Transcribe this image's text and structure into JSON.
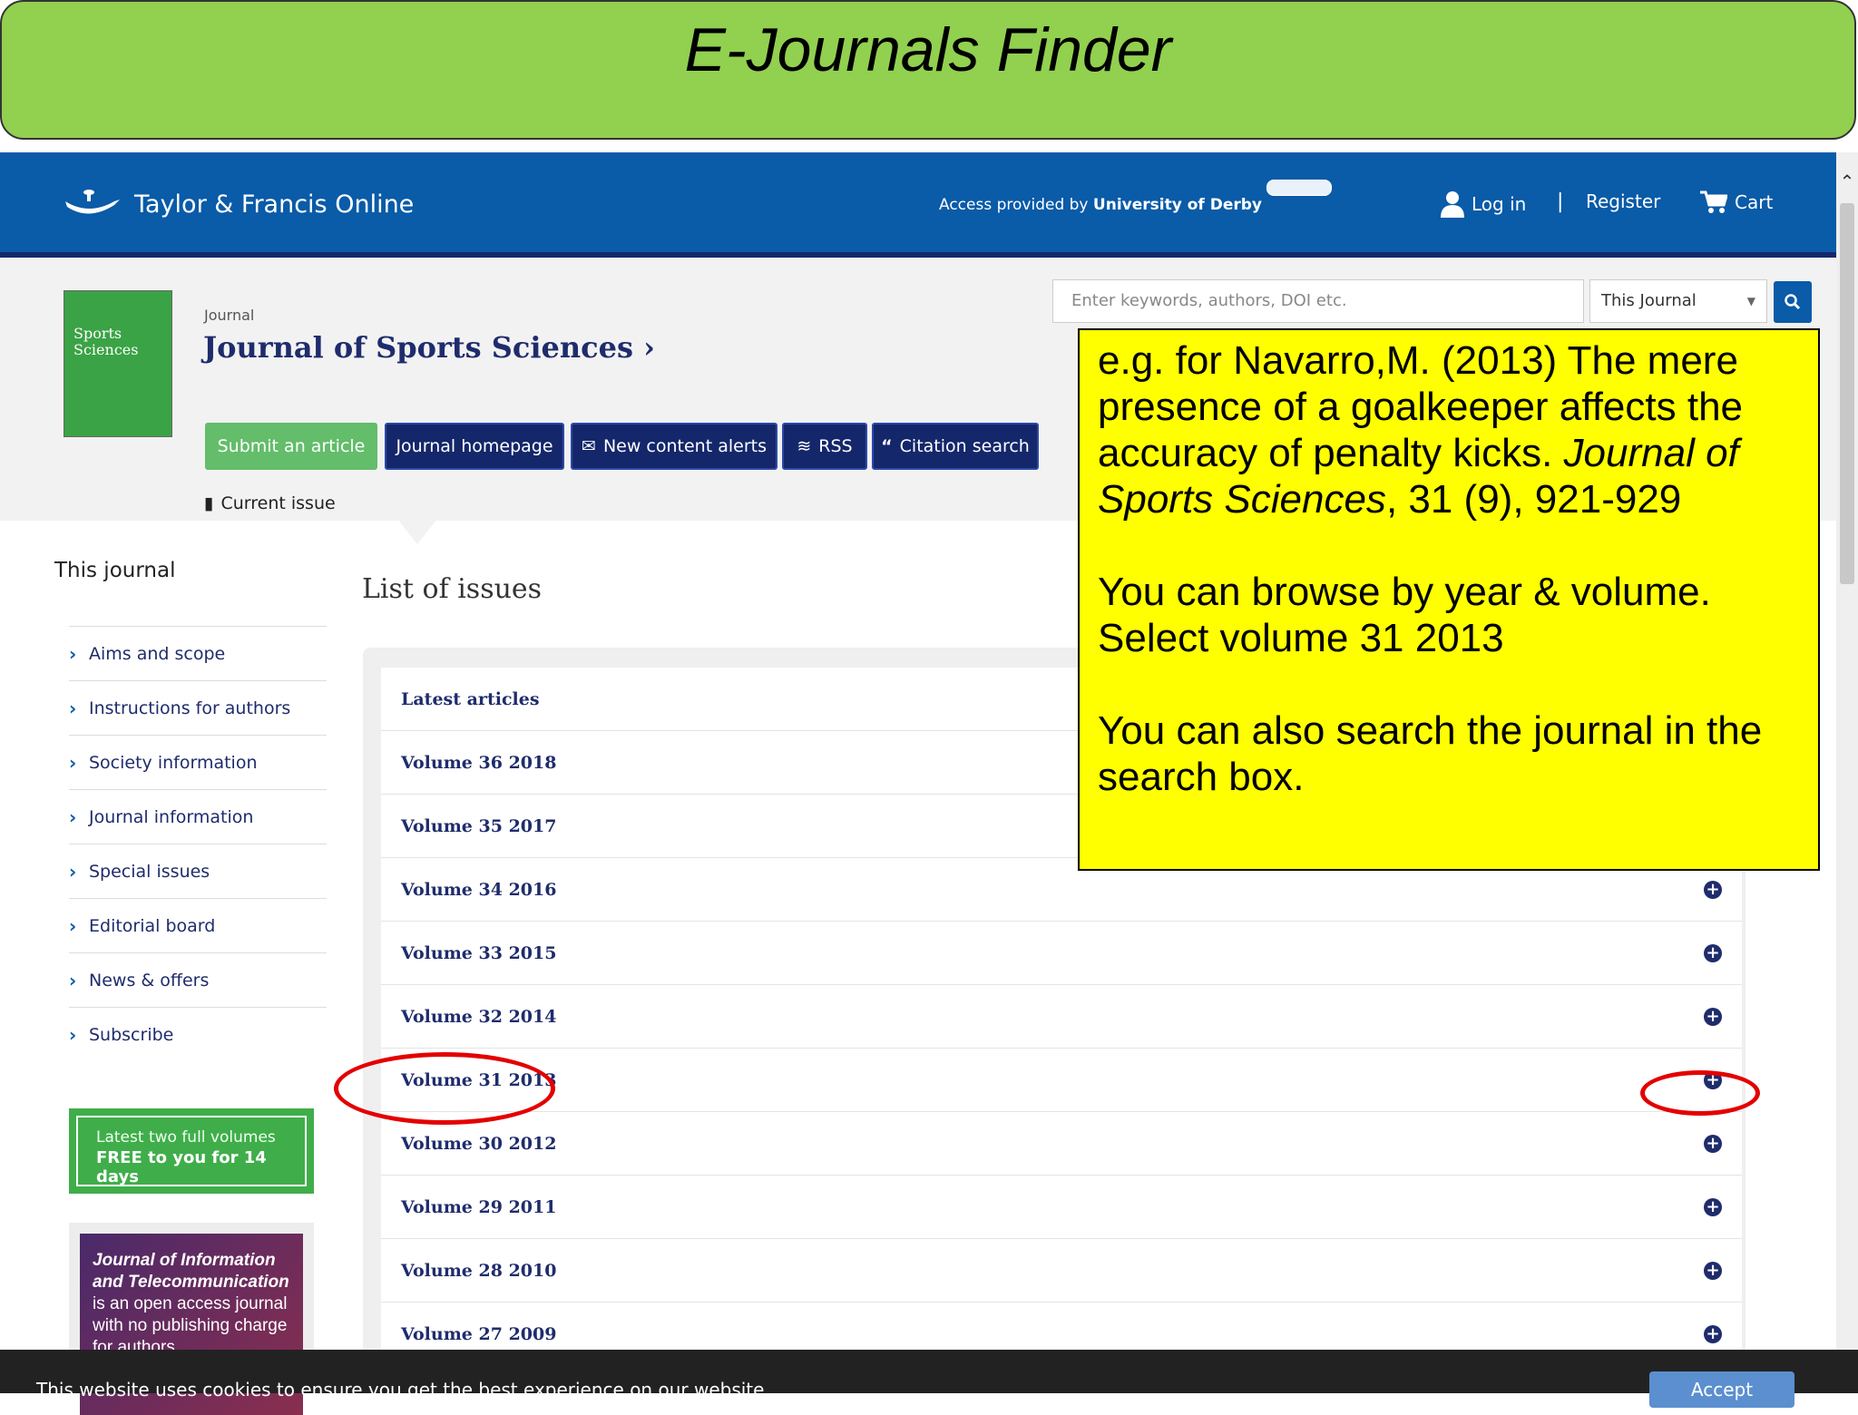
{
  "banner": {
    "title": "E-Journals Finder"
  },
  "header": {
    "logo_text": "Taylor & Francis Online",
    "access_prefix": "Access provided by",
    "access_institution": "University of Derby",
    "login": "Log in",
    "separator": "|",
    "register": "Register",
    "cart": "Cart"
  },
  "journal": {
    "label": "Journal",
    "title": "Journal of Sports Sciences",
    "cover_title": "Sports Sciences",
    "current_issue": "Current issue",
    "buttons": {
      "submit": "Submit an article",
      "homepage": "Journal homepage",
      "alerts": "New content alerts",
      "rss": "RSS",
      "citation": "Citation search"
    }
  },
  "search": {
    "placeholder": "Enter keywords, authors, DOI etc.",
    "scope": "This Journal"
  },
  "sidebar": {
    "heading": "This journal",
    "items": [
      {
        "label": "Aims and scope"
      },
      {
        "label": "Instructions for authors"
      },
      {
        "label": "Society information"
      },
      {
        "label": "Journal information"
      },
      {
        "label": "Special issues"
      },
      {
        "label": "Editorial board"
      },
      {
        "label": "News & offers"
      },
      {
        "label": "Subscribe"
      }
    ],
    "promo_line1": "Latest two full volumes",
    "promo_line2": "FREE to you for 14 days",
    "ad_title": "Journal of Information and Telecommunication",
    "ad_body": "is an open access journal with no publishing charge for authors"
  },
  "issues": {
    "heading": "List of issues",
    "rows": [
      {
        "label": "Latest articles"
      },
      {
        "label": "Volume 36 2018"
      },
      {
        "label": "Volume 35 2017"
      },
      {
        "label": "Volume 34 2016"
      },
      {
        "label": "Volume 33 2015"
      },
      {
        "label": "Volume 32 2014"
      },
      {
        "label": "Volume 31 2013"
      },
      {
        "label": "Volume 30 2012"
      },
      {
        "label": "Volume 29 2011"
      },
      {
        "label": "Volume 28 2010"
      },
      {
        "label": "Volume 27 2009"
      }
    ]
  },
  "note": {
    "p1_start": "e.g. for Navarro,M. (2013) The  mere presence of a goalkeeper affects the accuracy of  penalty kicks. ",
    "p1_italic": "Journal of Sports Sciences",
    "p1_end": ", 31 (9), 921-929",
    "p2": "You can browse by year & volume. Select volume 31 2013",
    "p3": "You can also search the journal in the search box."
  },
  "cookie": {
    "text": "This website uses cookies to ensure you get the best experience on our website.",
    "accept": "Accept"
  },
  "colors": {
    "banner": "#92d050",
    "header": "#0a5ba8",
    "navy": "#14276b",
    "note": "#ffff00",
    "highlight_ring": "#e30000"
  }
}
